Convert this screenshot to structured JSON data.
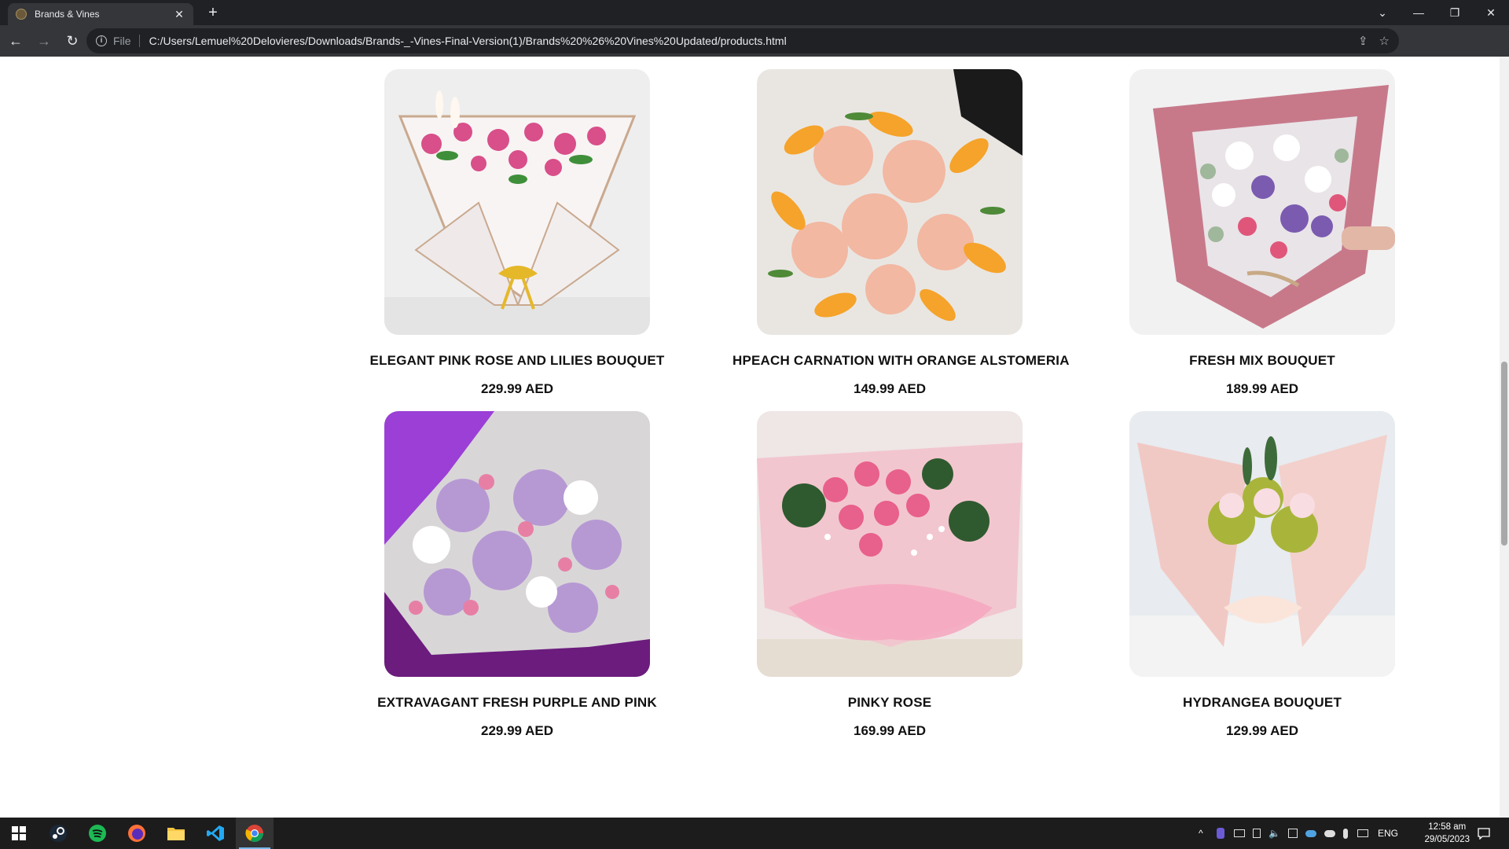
{
  "browser": {
    "tab_title": "Brands & Vines",
    "tab_close": "✕",
    "new_tab": "+",
    "window_controls": {
      "dropdown": "⌄",
      "minimize": "—",
      "restore": "❐",
      "close": "✕"
    },
    "nav": {
      "back": "←",
      "forward": "→",
      "reload": "↻"
    },
    "omnibox": {
      "info_icon": "i",
      "scheme_label": "File",
      "url": "C:/Users/Lemuel%20Delovieres/Downloads/Brands-_-Vines-Final-Version(1)/Brands%20%26%20Vines%20Updated/products.html"
    },
    "toolbar_icons": {
      "share": "⇪",
      "bookmark": "☆",
      "side_panel": "▯",
      "profile": "●",
      "menu": "⋮"
    }
  },
  "products": [
    {
      "name": "ELEGANT PINK ROSE AND LILIES BOUQUET",
      "price": "229.99 AED",
      "image": "bouquet-white-wrap-pink-roses"
    },
    {
      "name": "HPEACH CARNATION WITH ORANGE ALSTOMERIA",
      "price": "149.99 AED",
      "image": "bouquet-peach-carnation"
    },
    {
      "name": "FRESH MIX BOUQUET",
      "price": "189.99 AED",
      "image": "bouquet-mauve-wrap-mixed"
    },
    {
      "name": "EXTRAVAGANT FRESH PURPLE AND PINK",
      "price": "229.99 AED",
      "image": "bouquet-purple-chrysanthemum"
    },
    {
      "name": "PINKY ROSE",
      "price": "169.99 AED",
      "image": "bouquet-pink-roses-mesh"
    },
    {
      "name": "HYDRANGEA BOUQUET",
      "price": "129.99 AED",
      "image": "bouquet-lace-wrap-roses"
    }
  ],
  "taskbar": {
    "apps": [
      "windows-start",
      "steam",
      "spotify",
      "firefox",
      "file-explorer",
      "vscode",
      "chrome"
    ],
    "tray_up_arrow": "^",
    "language": "ENG",
    "time": "12:58 am",
    "date": "29/05/2023"
  }
}
